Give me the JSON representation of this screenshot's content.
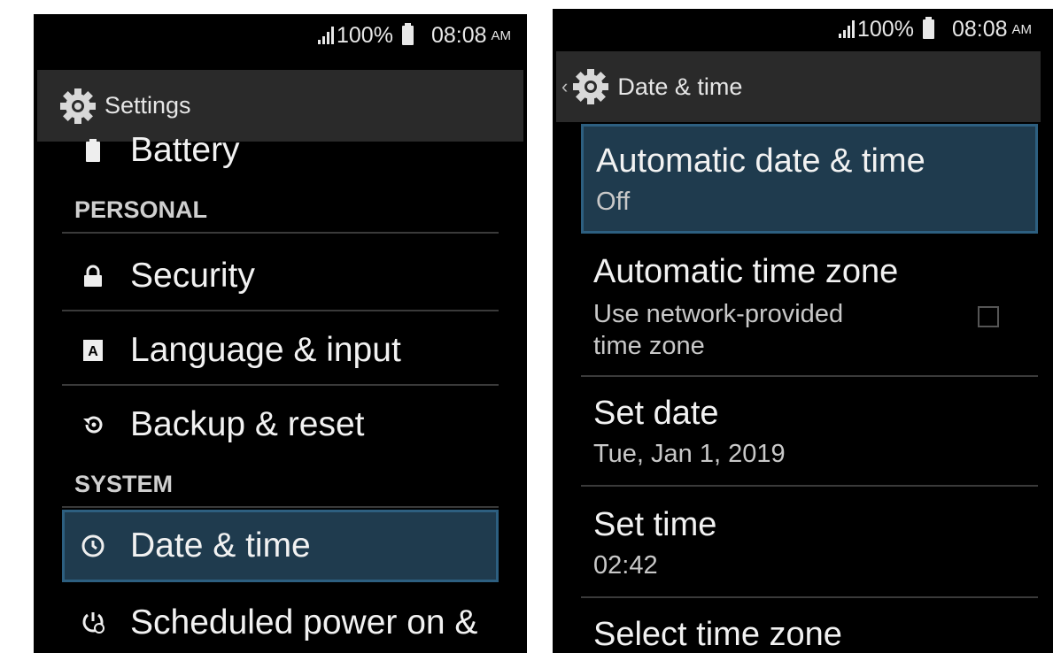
{
  "status_bar": {
    "battery": "100%",
    "time": "08:08",
    "ampm": "AM"
  },
  "left_screen": {
    "title": "Settings",
    "items": {
      "battery": "Battery",
      "personal_header": "PERSONAL",
      "security": "Security",
      "language": "Language & input",
      "backup": "Backup & reset",
      "system_header": "SYSTEM",
      "date_time": "Date & time",
      "scheduled_power": "Scheduled power on &"
    },
    "selected_item": "Date & time"
  },
  "right_screen": {
    "title": "Date & time",
    "items": [
      {
        "title": "Automatic date & time",
        "subtitle": "Off",
        "selected": true
      },
      {
        "title": "Automatic time zone",
        "subtitle_line1": "Use network-provided",
        "subtitle_line2": "time zone",
        "checked": false
      },
      {
        "title": "Set date",
        "subtitle": "Tue, Jan 1, 2019"
      },
      {
        "title": "Set time",
        "subtitle": "02:42"
      },
      {
        "title": "Select time zone"
      }
    ]
  },
  "colors": {
    "selected_bg": "#1f3b4e",
    "selected_border": "#2d5f80",
    "action_bar": "#2a2a2a"
  }
}
